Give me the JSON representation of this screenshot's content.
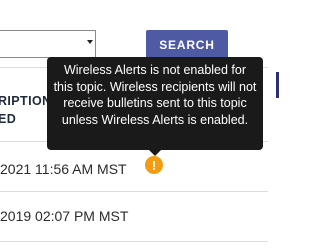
{
  "search": {
    "button_label": "SEARCH",
    "select_value": ""
  },
  "table": {
    "header_line1": "RIPTION",
    "header_line2": "ED",
    "rows": [
      {
        "date": "2021 11:56 AM MST",
        "status_icon": "warning-icon"
      },
      {
        "date": "2019 02:07 PM MST"
      }
    ]
  },
  "tooltip": {
    "text": "Wireless Alerts is not enabled for this topic. Wireless recipients will not receive bulletins sent to this topic unless Wireless Alerts is enabled."
  },
  "warning_icon_glyph": "!",
  "colors": {
    "accent": "#4f5aa4",
    "warning": "#f39c12",
    "tooltip_bg": "#1a1a1a"
  }
}
